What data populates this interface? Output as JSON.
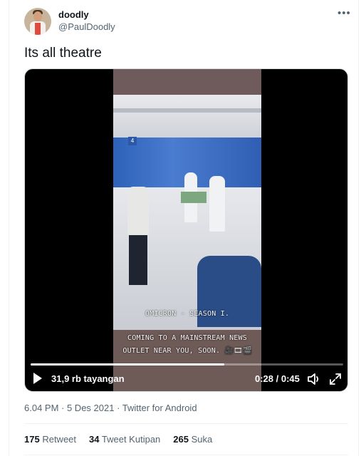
{
  "author": {
    "display_name": "doodly",
    "handle": "@PaulDoodly",
    "avatar_icon": "user-avatar"
  },
  "more_icon": "ellipsis-icon",
  "tweet": {
    "text": "Its all theatre",
    "timestamp": "6.04 PM · 5 Des 2021 · Twitter for Android"
  },
  "video": {
    "caption_line1": "OMICRON - SEASON I.",
    "caption_line2": "COMING TO A MAINSTREAM NEWS",
    "caption_line3": "OUTLET NEAR YOU, SOON.",
    "caption_emoji": "🎥🎞🎬",
    "views": "31,9 rb tayangan",
    "time": "0:28 / 0:45",
    "progress": 0.62,
    "ward_number": "4",
    "icons": {
      "play": "play-icon",
      "volume": "volume-icon",
      "fullscreen": "fullscreen-icon"
    }
  },
  "stats": {
    "retweet_count": "175",
    "retweet_label": "Retweet",
    "quote_count": "34",
    "quote_label": "Tweet Kutipan",
    "like_count": "265",
    "like_label": "Suka"
  }
}
